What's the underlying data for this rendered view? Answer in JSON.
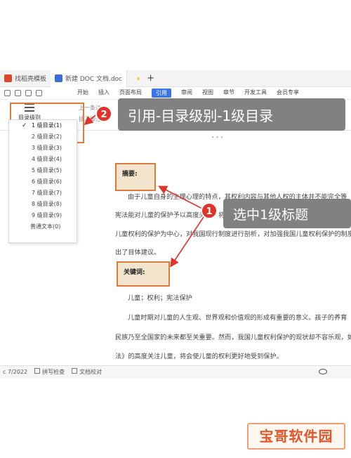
{
  "tabs": [
    {
      "label": "找稻壳模板",
      "color": "#e0462c"
    },
    {
      "label": "新建 DOC 文档.doc",
      "color": "#3a6fd8"
    }
  ],
  "ribbon": {
    "menu": [
      "开始",
      "插入",
      "页面布局",
      "引用",
      "审阅",
      "视图",
      "章节",
      "开发工具",
      "会员专享"
    ],
    "active": "引用"
  },
  "toc_button": {
    "label": "目录级别"
  },
  "ribbon_faded": {
    "a": "上一条注",
    "b": "插入脚注"
  },
  "toc_levels": [
    {
      "label": "1 级目录(1)",
      "checked": true
    },
    {
      "label": "2 级目录(2)",
      "checked": false
    },
    {
      "label": "3 级目录(3)",
      "checked": false
    },
    {
      "label": "4 级目录(4)",
      "checked": false
    },
    {
      "label": "5 级目录(5)",
      "checked": false
    },
    {
      "label": "6 级目录(6)",
      "checked": false
    },
    {
      "label": "7 级目录(7)",
      "checked": false
    },
    {
      "label": "8 级目录(8)",
      "checked": false
    },
    {
      "label": "9 级目录(9)",
      "checked": false
    },
    {
      "label": "普通文本(0)",
      "checked": false
    }
  ],
  "callouts": {
    "step2": {
      "badge": "2",
      "text": "引用-目录级别-1级目录"
    },
    "step1": {
      "badge": "1",
      "text": "选中1级标题"
    }
  },
  "document": {
    "abstract_label": "摘要:",
    "abstract_lines": [
      "由于儿童自身的生理心理的特点，其权利内容与其他人权的主体并不能完全等",
      "宪法能对儿童的保护予以高度关注，将儿童",
      "儿童权利的保护为中心，对我国现行制度进行剖析，对加强我国儿童权利保护的制度",
      "出了目体建议。"
    ],
    "keywords_label": "关键词:",
    "keywords": "儿童；权利；宪法保护",
    "body_lines": [
      "儿童时期对儿童的人生观、世界观和价值观的形成有重要的意义。孩子的养育",
      "民族乃至全国家的未来都至关重要。然而，我国儿童权利保护的现状却不容乐观，如果",
      "法》的高度关注儿童，将会使儿童的权利更好地受到保护。"
    ]
  },
  "statusbar": {
    "pages": "c 7/2022",
    "spell": "拼写检查",
    "proof": "文档校对"
  },
  "watermark": "宝哥软件园",
  "colors": {
    "accent": "#3b74e8",
    "highlight_box": "#e07a3a",
    "badge": "#e2332b"
  }
}
